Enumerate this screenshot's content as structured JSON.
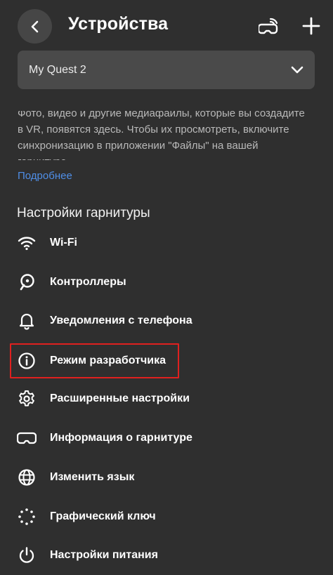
{
  "header": {
    "title": "Устройства"
  },
  "device_selector": {
    "value": "My Quest 2"
  },
  "info": {
    "text": "Фото, видео и другие медиафайлы, которые вы создадите в VR, появятся здесь. Чтобы их просмотреть, включите синхронизацию в приложении \"Файлы\" на вашей гарнитуре.",
    "link": "Подробнее"
  },
  "section": {
    "title": "Настройки гарнитуры",
    "items": [
      {
        "label": "Wi-Fi",
        "icon": "wifi-icon"
      },
      {
        "label": "Контроллеры",
        "icon": "controller-icon"
      },
      {
        "label": "Уведомления с телефона",
        "icon": "bell-icon"
      },
      {
        "label": "Режим разработчика",
        "icon": "info-icon"
      },
      {
        "label": "Расширенные настройки",
        "icon": "gear-icon"
      },
      {
        "label": "Информация о гарнитуре",
        "icon": "headset-icon"
      },
      {
        "label": "Изменить язык",
        "icon": "globe-icon"
      },
      {
        "label": "Графический ключ",
        "icon": "pattern-icon"
      },
      {
        "label": "Настройки питания",
        "icon": "power-icon"
      }
    ]
  },
  "colors": {
    "background": "#2f2f2f",
    "link": "#4f8ee6",
    "highlight": "#e0201f"
  }
}
